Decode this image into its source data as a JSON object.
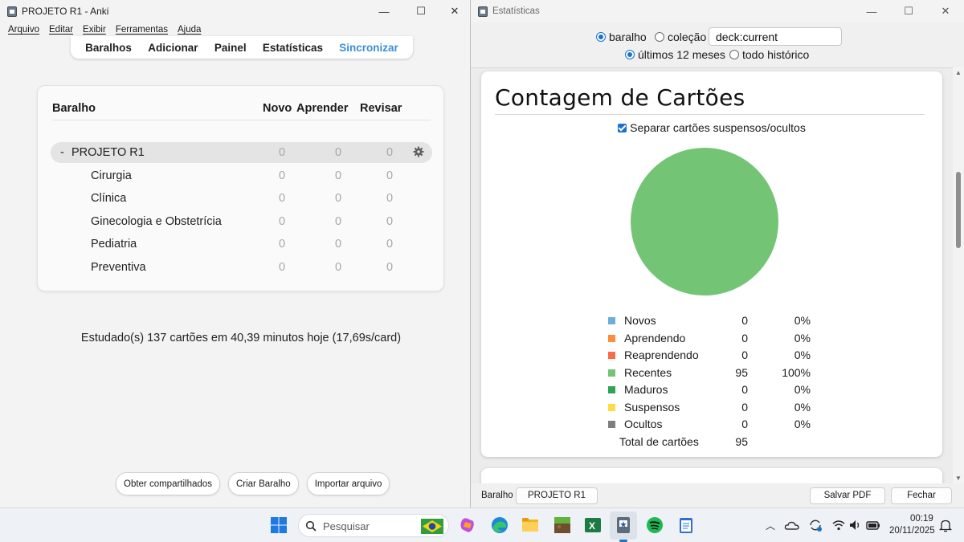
{
  "anki_window": {
    "title": "PROJETO R1 - Anki",
    "controls": {
      "minimize": "—",
      "maximize": "☐",
      "close": "✕"
    },
    "menu": [
      "Arquivo",
      "Editar",
      "Exibir",
      "Ferramentas",
      "Ajuda"
    ],
    "toolbar": [
      "Baralhos",
      "Adicionar",
      "Painel",
      "Estatísticas",
      "Sincronizar"
    ],
    "deck_table": {
      "headers": {
        "deck": "Baralho",
        "new": "Novo",
        "learn": "Aprender",
        "review": "Revisar"
      },
      "parent": {
        "prefix": "-",
        "name": "PROJETO R1",
        "new": "0",
        "learn": "0",
        "review": "0"
      },
      "children": [
        {
          "name": "Cirurgia",
          "new": "0",
          "learn": "0",
          "review": "0"
        },
        {
          "name": "Clínica",
          "new": "0",
          "learn": "0",
          "review": "0"
        },
        {
          "name": "Ginecologia e Obstetrícia",
          "new": "0",
          "learn": "0",
          "review": "0"
        },
        {
          "name": "Pediatria",
          "new": "0",
          "learn": "0",
          "review": "0"
        },
        {
          "name": "Preventiva",
          "new": "0",
          "learn": "0",
          "review": "0"
        }
      ]
    },
    "studied_text": "Estudado(s) 137 cartões em 40,39 minutos hoje (17,69s/card)",
    "bottom_buttons": [
      "Obter compartilhados",
      "Criar Baralho",
      "Importar arquivo"
    ]
  },
  "stats_window": {
    "title": "Estatísticas",
    "scope": {
      "deck_label": "baralho",
      "collection_label": "coleção",
      "selected": "baralho",
      "search_value": "deck:current"
    },
    "period": {
      "last12_label": "últimos 12 meses",
      "all_label": "todo histórico",
      "selected": "últimos 12 meses"
    },
    "card": {
      "title": "Contagem de Cartões",
      "checkbox_label": "Separar cartões suspensos/ocultos",
      "checkbox_checked": true
    },
    "bottom": {
      "deck_label": "Baralho",
      "deck_button": "PROJETO R1",
      "save_pdf": "Salvar PDF",
      "close": "Fechar"
    }
  },
  "chart_data": {
    "type": "pie",
    "title": "Contagem de Cartões",
    "series": [
      {
        "name": "Novos",
        "value": 0,
        "percent": "0%",
        "color": "#6baed6"
      },
      {
        "name": "Aprendendo",
        "value": 0,
        "percent": "0%",
        "color": "#fd8d3c"
      },
      {
        "name": "Reaprendendo",
        "value": 0,
        "percent": "0%",
        "color": "#fb6a4a"
      },
      {
        "name": "Recentes",
        "value": 95,
        "percent": "100%",
        "color": "#74c476"
      },
      {
        "name": "Maduros",
        "value": 0,
        "percent": "0%",
        "color": "#31a354"
      },
      {
        "name": "Suspensos",
        "value": 0,
        "percent": "0%",
        "color": "#ffdc41"
      },
      {
        "name": "Ocultos",
        "value": 0,
        "percent": "0%",
        "color": "#7f7f7f"
      }
    ],
    "total_label": "Total de cartões",
    "total": 95
  },
  "taskbar": {
    "search_placeholder": "Pesquisar",
    "time": "00:19",
    "date": "20/11/2025",
    "icons": [
      "windows-start-icon",
      "copilot-icon",
      "edge-icon",
      "file-explorer-icon",
      "minecraft-icon",
      "excel-icon",
      "anki-icon",
      "spotify-icon",
      "notepad-icon"
    ]
  }
}
